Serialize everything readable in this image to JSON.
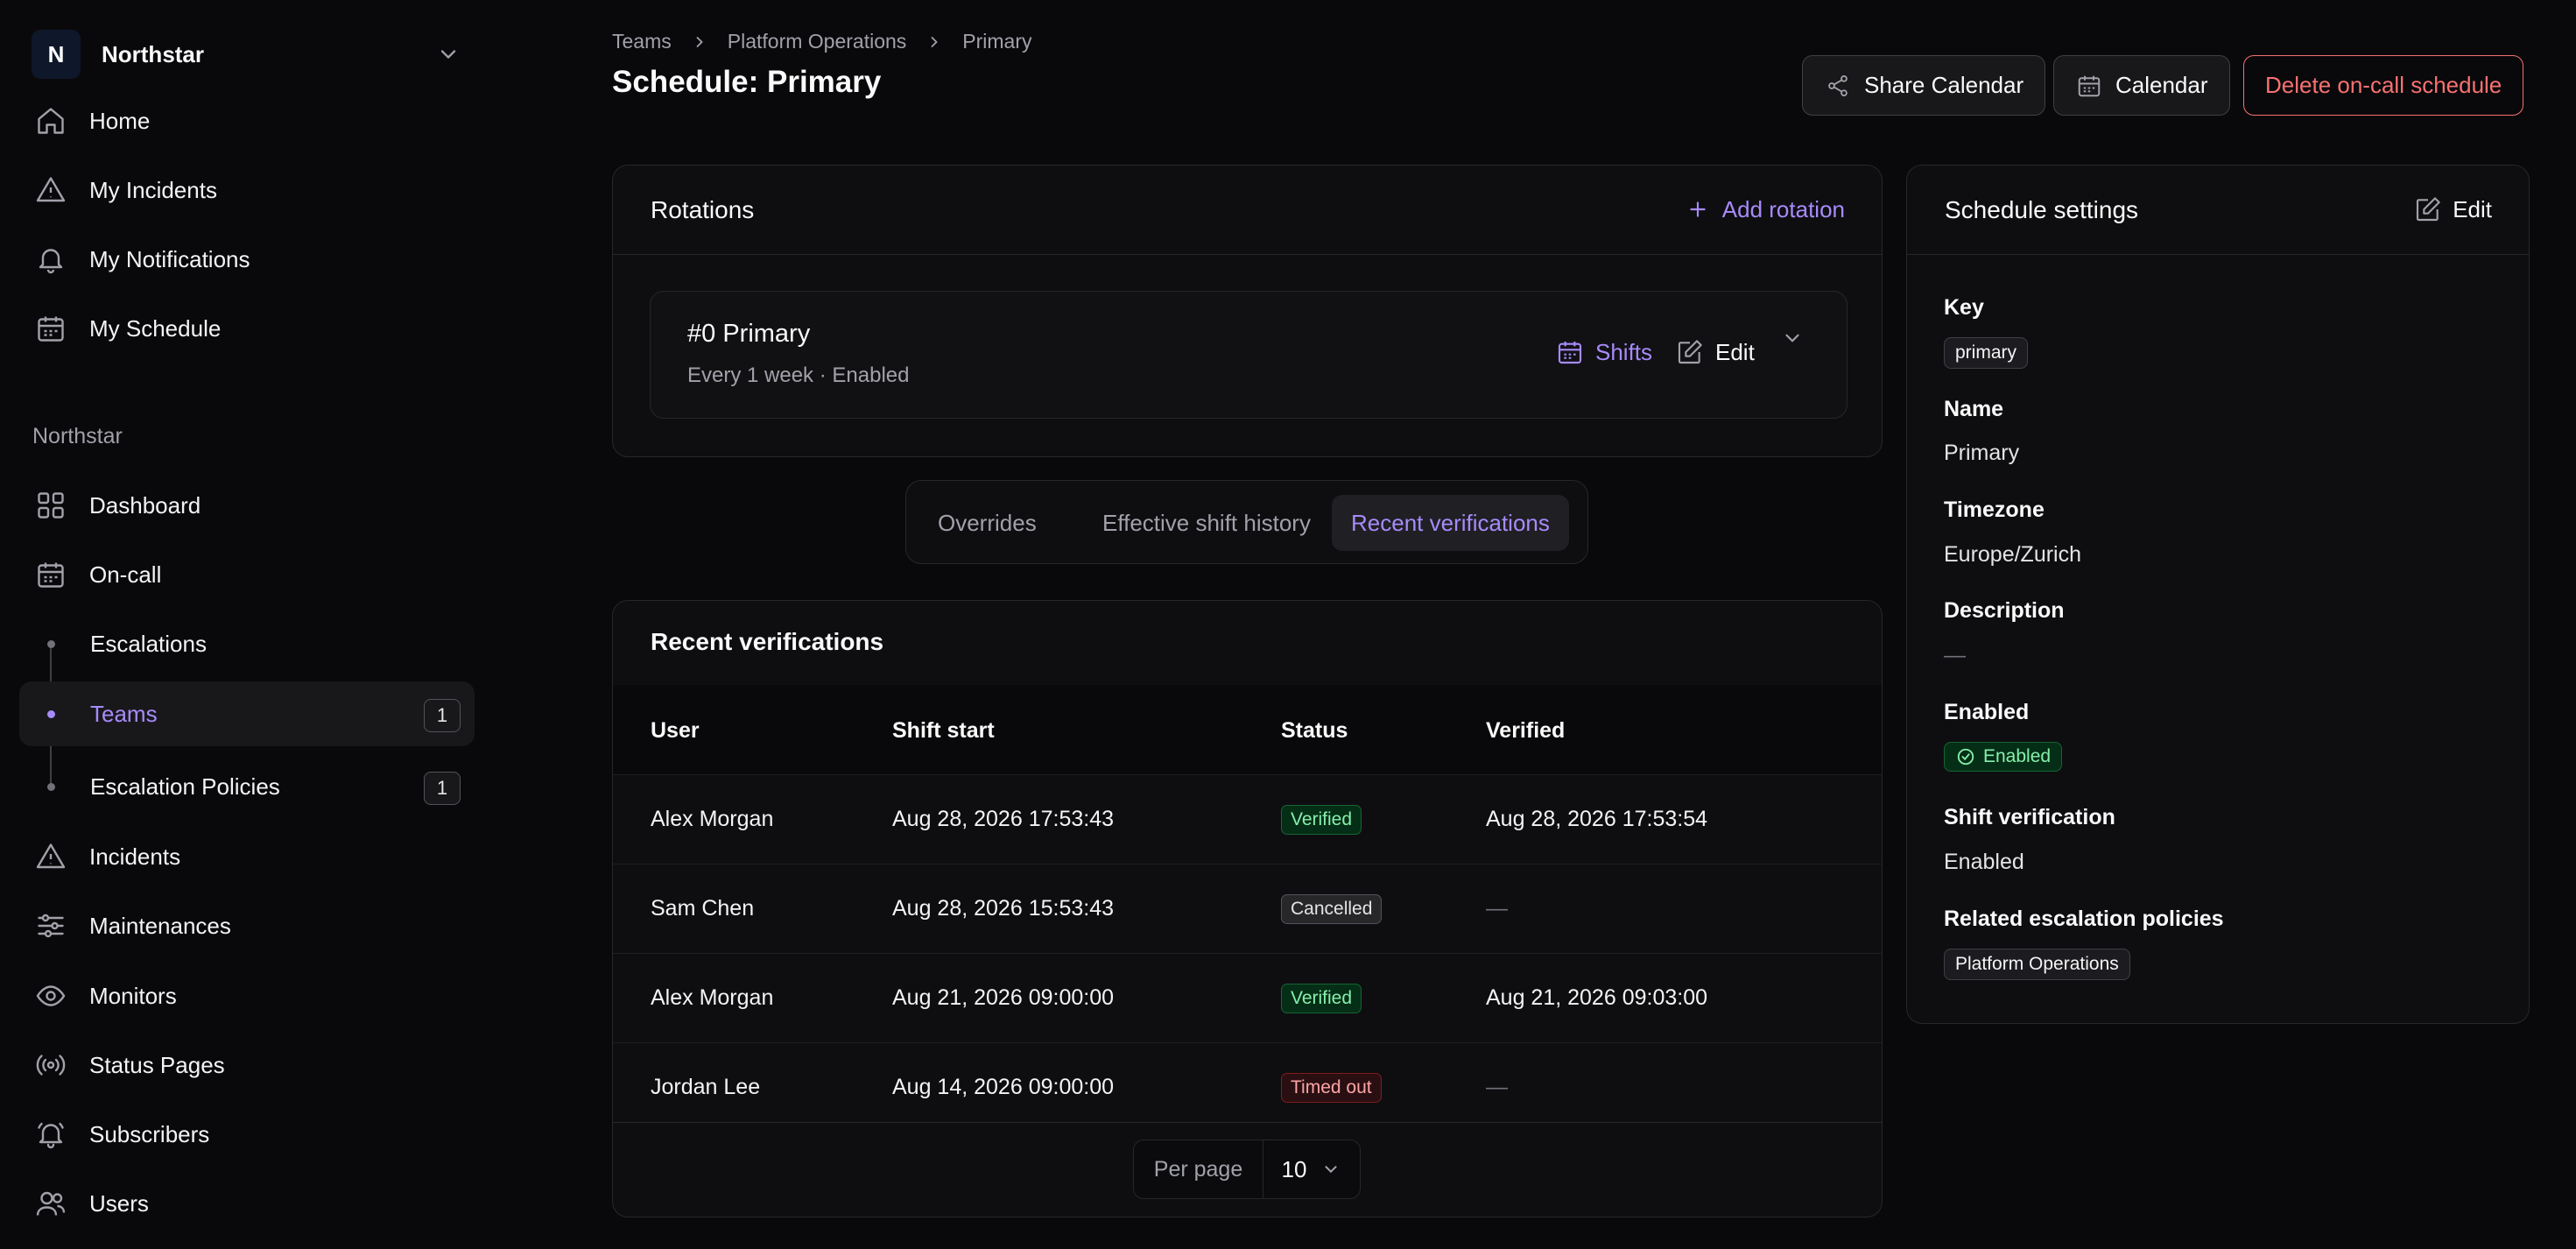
{
  "org": {
    "initial": "N",
    "name": "Northstar"
  },
  "nav_top": [
    {
      "label": "Home",
      "icon": "home-icon"
    },
    {
      "label": "My Incidents",
      "icon": "alert-triangle-icon"
    },
    {
      "label": "My Notifications",
      "icon": "bell-icon"
    },
    {
      "label": "My Schedule",
      "icon": "calendar-icon"
    }
  ],
  "nav_section_label": "Northstar",
  "nav_main": [
    {
      "label": "Dashboard",
      "icon": "grid-icon"
    },
    {
      "label": "On-call",
      "icon": "calendar-icon"
    },
    {
      "label": "Escalations",
      "sub": true
    },
    {
      "label": "Teams",
      "sub": true,
      "active": true,
      "count": "1"
    },
    {
      "label": "Escalation Policies",
      "sub": true,
      "count": "1"
    },
    {
      "label": "Incidents",
      "icon": "alert-triangle-icon"
    },
    {
      "label": "Maintenances",
      "icon": "sliders-icon"
    },
    {
      "label": "Monitors",
      "icon": "eye-icon"
    },
    {
      "label": "Status Pages",
      "icon": "broadcast-icon"
    },
    {
      "label": "Subscribers",
      "icon": "bell-ring-icon"
    },
    {
      "label": "Users",
      "icon": "users-icon"
    }
  ],
  "breadcrumb": [
    "Teams",
    "Platform Operations",
    "Primary"
  ],
  "page_title": "Schedule: Primary",
  "header_buttons": {
    "share_calendar": "Share Calendar",
    "calendar": "Calendar",
    "delete": "Delete on-call schedule"
  },
  "rotations": {
    "title": "Rotations",
    "add_label": "Add rotation",
    "item": {
      "title": "#0 Primary",
      "subtitle": "Every 1 week · Enabled",
      "shifts_label": "Shifts",
      "edit_label": "Edit"
    }
  },
  "tabs": [
    {
      "label": "Overrides",
      "active": false
    },
    {
      "label": "Effective shift history",
      "active": false
    },
    {
      "label": "Recent verifications",
      "active": true
    }
  ],
  "verifications": {
    "title": "Recent verifications",
    "columns": [
      "User",
      "Shift start",
      "Status",
      "Verified"
    ],
    "rows": [
      {
        "user": "Alex Morgan",
        "shift_start": "Aug 28, 2026 17:53:43",
        "status": "Verified",
        "status_kind": "verified",
        "verified": "Aug 28, 2026 17:53:54"
      },
      {
        "user": "Sam Chen",
        "shift_start": "Aug 28, 2026 15:53:43",
        "status": "Cancelled",
        "status_kind": "cancelled",
        "verified": "—"
      },
      {
        "user": "Alex Morgan",
        "shift_start": "Aug 21, 2026 09:00:00",
        "status": "Verified",
        "status_kind": "verified",
        "verified": "Aug 21, 2026 09:03:00"
      },
      {
        "user": "Jordan Lee",
        "shift_start": "Aug 14, 2026 09:00:00",
        "status": "Timed out",
        "status_kind": "timedout",
        "verified": "—"
      }
    ],
    "per_page_label": "Per page",
    "per_page_value": "10"
  },
  "settings": {
    "title": "Schedule settings",
    "edit_label": "Edit",
    "key_label": "Key",
    "key_value": "primary",
    "name_label": "Name",
    "name_value": "Primary",
    "timezone_label": "Timezone",
    "timezone_value": "Europe/Zurich",
    "description_label": "Description",
    "description_value": "—",
    "enabled_label": "Enabled",
    "enabled_value": "Enabled",
    "shift_verification_label": "Shift verification",
    "shift_verification_value": "Enabled",
    "related_label": "Related escalation policies",
    "related_value": "Platform Operations"
  },
  "colors": {
    "accent": "#a78bfa",
    "danger": "#f87171",
    "success": "#86efac",
    "background": "#09090b"
  }
}
